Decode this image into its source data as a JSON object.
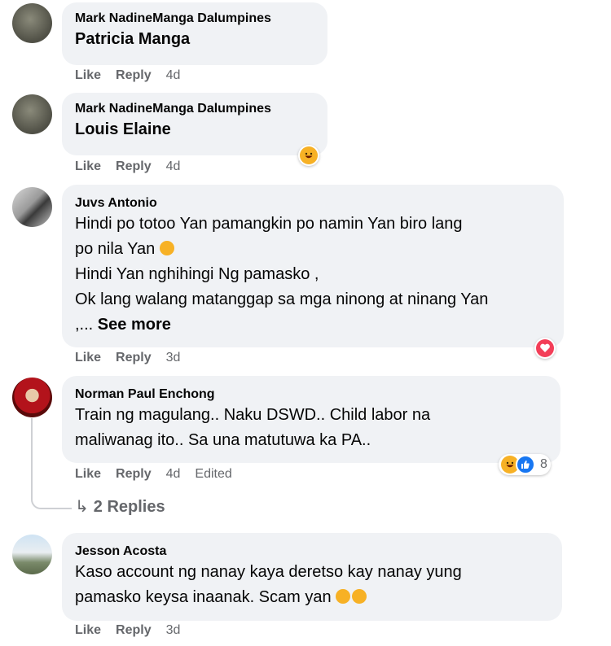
{
  "comments": [
    {
      "author": "Mark NadineManga Dalumpines",
      "text": "Patricia Manga",
      "actions": {
        "like": "Like",
        "reply": "Reply",
        "time": "4d",
        "edited": ""
      }
    },
    {
      "author": "Mark NadineManga Dalumpines",
      "text": "Louis Elaine",
      "actions": {
        "like": "Like",
        "reply": "Reply",
        "time": "4d",
        "edited": ""
      },
      "reaction": "haha"
    },
    {
      "author": "Juvs Antonio",
      "lines": [
        "Hindi po totoo Yan pamangkin po namin Yan biro lang",
        "po nila Yan",
        "Hindi Yan nghihingi Ng pamasko ,",
        "Ok lang walang matanggap sa mga ninong at ninang Yan",
        ",...",
        "See more"
      ],
      "actions": {
        "like": "Like",
        "reply": "Reply",
        "time": "3d",
        "edited": ""
      },
      "reaction": "love"
    },
    {
      "author": "Norman Paul Enchong",
      "lines": [
        "Train ng magulang.. Naku DSWD.. Child labor na",
        "maliwanag ito.. Sa una matutuwa ka PA.."
      ],
      "actions": {
        "like": "Like",
        "reply": "Reply",
        "time": "4d",
        "edited": "Edited"
      },
      "reactions": [
        "haha",
        "like"
      ],
      "reaction_count": "8",
      "replies_label": "2 Replies"
    },
    {
      "author": "Jesson Acosta",
      "lines": [
        "Kaso account ng nanay kaya deretso kay nanay yung",
        "pamasko keysa inaanak. Scam yan"
      ],
      "actions": {
        "like": "Like",
        "reply": "Reply",
        "time": "3d",
        "edited": ""
      }
    }
  ],
  "colors": {
    "bubble": "#f0f2f5",
    "meta": "#65676b",
    "like_blue": "#1877f2",
    "love_red": "#f33e58",
    "haha_yellow": "#f7b125"
  }
}
